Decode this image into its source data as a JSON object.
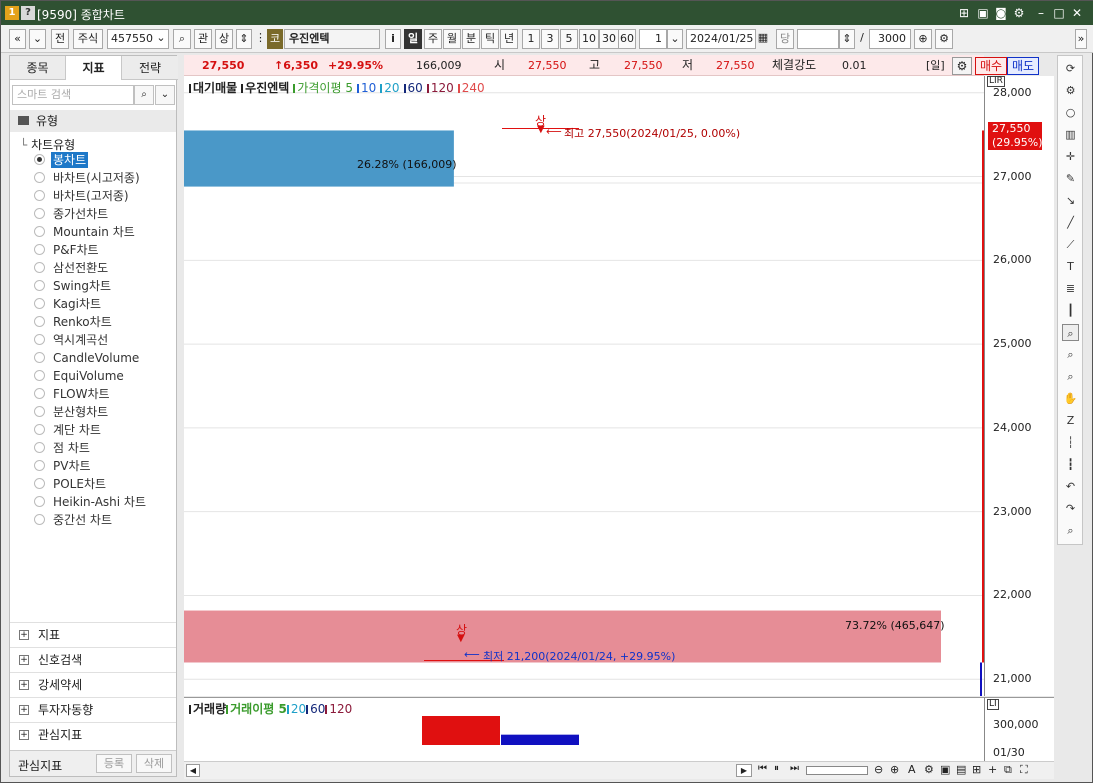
{
  "window": {
    "title": "[9590] 종합차트",
    "badges": [
      "1",
      "?"
    ],
    "controls": [
      "layout-icon",
      "save-icon",
      "camera-icon",
      "gear-icon",
      "minimize-icon",
      "maximize-icon",
      "close-icon"
    ]
  },
  "toolbar": {
    "nav_first": "«",
    "nav_down": "»",
    "prev": "전",
    "market": "주식",
    "code": "457550",
    "gwan": "관",
    "sang": "상",
    "badge": "코",
    "stock_name": "우진엔텍",
    "info": "i",
    "periods": [
      "일",
      "주",
      "월",
      "분",
      "틱",
      "년"
    ],
    "active_period": "일",
    "intervals": [
      "1",
      "3",
      "5",
      "10",
      "30",
      "60"
    ],
    "count": "1",
    "date": "2024/01/25",
    "dang": "당",
    "slash": "/",
    "limit": "3000",
    "expand": "»"
  },
  "left_panel": {
    "tabs": [
      "종목",
      "지표",
      "전략"
    ],
    "active_tab": "지표",
    "search_placeholder": "스마트 검색",
    "type_header": "유형",
    "tree_root": "차트유형",
    "chart_types": [
      "봉차트",
      "바차트(시고저종)",
      "바차트(고저종)",
      "종가선차트",
      "Mountain 차트",
      "P&F차트",
      "삼선전환도",
      "Swing차트",
      "Kagi차트",
      "Renko차트",
      "역시계곡선",
      "CandleVolume",
      "EquiVolume",
      "FLOW차트",
      "분산형차트",
      "계단 차트",
      "점 차트",
      "PV차트",
      "POLE차트",
      "Heikin-Ashi 차트",
      "중간선 차트"
    ],
    "selected_type": "봉차트",
    "groups": [
      "지표",
      "신호검색",
      "강세약세",
      "투자자동향",
      "관심지표"
    ],
    "bottom_label": "관심지표",
    "register": "등록",
    "delete": "삭제"
  },
  "price_bar": {
    "price": "27,550",
    "change": "↑6,350",
    "rate": "+29.95%",
    "volume": "166,009",
    "open_label": "시",
    "open": "27,550",
    "high_label": "고",
    "high": "27,550",
    "low_label": "저",
    "low": "27,550",
    "strength_label": "체결강도",
    "strength": "0.01",
    "period_tag": "[일]",
    "buy": "매수",
    "sell": "매도"
  },
  "chart": {
    "legend": [
      {
        "text": "대기매물",
        "color": "#222222"
      },
      {
        "text": "우진엔텍",
        "color": "#222222"
      },
      {
        "text": "가격이평 5",
        "color": "#3a9b2c"
      },
      {
        "text": "10",
        "color": "#1f5fd6"
      },
      {
        "text": "20",
        "color": "#1fa0c8"
      },
      {
        "text": "60",
        "color": "#14287a"
      },
      {
        "text": "120",
        "color": "#8b1a3a"
      },
      {
        "text": "240",
        "color": "#e04a4a"
      }
    ],
    "axis_badges": [
      "L",
      "I",
      "R"
    ],
    "y_ticks": [
      "28,000",
      "27,000",
      "26,000",
      "25,000",
      "24,000",
      "23,000",
      "22,000",
      "21,000"
    ],
    "current_price_tag": "27,550",
    "current_rate_tag": "(29.95%)",
    "high_marker": "상",
    "high_annotation": "최고 27,550(2024/01/25, 0.00%)",
    "low_marker": "상",
    "low_annotation": "최저 21,200(2024/01/24, +29.95%)",
    "profile_upper_label": "26.28% (166,009)",
    "profile_lower_label": "73.72% (465,647)",
    "colors": {
      "upper_bar": "#4a98c8",
      "lower_bar": "#e68d96",
      "up": "#e01010",
      "down": "#1010c0"
    }
  },
  "chart_data": {
    "type": "bar",
    "title": "",
    "ylim": [
      20800,
      28200
    ],
    "volume_profile": [
      {
        "price_from": 26880,
        "price_to": 27550,
        "percent": 26.28,
        "volume": 166009
      },
      {
        "price_from": 21200,
        "price_to": 21820,
        "percent": 73.72,
        "volume": 465647
      }
    ],
    "candles": [
      {
        "date": "2024/01/24",
        "open": 21200,
        "high": 21200,
        "low": 21200,
        "close": 21200,
        "volume": 465647,
        "color": "down"
      },
      {
        "date": "2024/01/25",
        "open": 21200,
        "high": 27550,
        "low": 21200,
        "close": 27550,
        "volume": 166009,
        "color": "up"
      }
    ]
  },
  "volume_pane": {
    "legend": [
      {
        "text": "거래량",
        "color": "#222222"
      },
      {
        "text": "거래이평 5",
        "color": "#3a9b2c"
      },
      {
        "text": "20",
        "color": "#1fa0c8"
      },
      {
        "text": "60",
        "color": "#14287a"
      },
      {
        "text": "120",
        "color": "#8b1a3a"
      }
    ],
    "tick": "300,000",
    "date_tick": "01/30",
    "bars": [
      {
        "value": 465647,
        "color": "#e01010"
      },
      {
        "value": 166009,
        "color": "#1010c0"
      }
    ]
  },
  "right_tools": [
    "refresh-icon",
    "gear-icon",
    "circle-icon",
    "chart-icon",
    "cross-icon",
    "pen-icon",
    "arrow-icon",
    "line-icon",
    "auto-line-icon",
    "text-icon",
    "fibo-icon",
    "candle-icon",
    "zoom-icon",
    "zoom-list-icon",
    "search-icon",
    "hand-icon",
    "z-icon",
    "vertical-lines-icon",
    "grid-lines-icon",
    "undo-icon",
    "redo-icon",
    "magnify-icon"
  ]
}
